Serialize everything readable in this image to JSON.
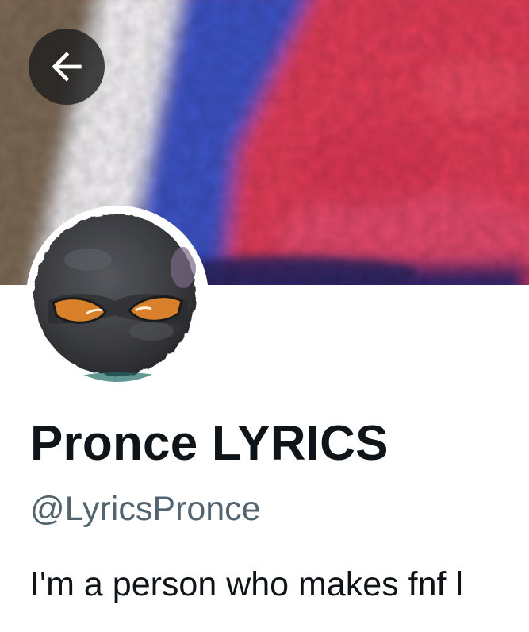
{
  "profile": {
    "display_name": "Pronce LYRICS",
    "handle": "@LyricsPronce",
    "bio": "I'm a person who makes fnf l"
  },
  "header": {
    "back_icon": "arrow-left-icon"
  },
  "colors": {
    "name_text": "#0f1419",
    "handle_text": "#536471",
    "banner_red": "#e34159",
    "banner_blue": "#3f55c8",
    "banner_white": "#f3f1f4",
    "banner_brown": "#7f6c55",
    "avatar_body": "#3c3d40",
    "avatar_eyes": "#d9802a"
  }
}
